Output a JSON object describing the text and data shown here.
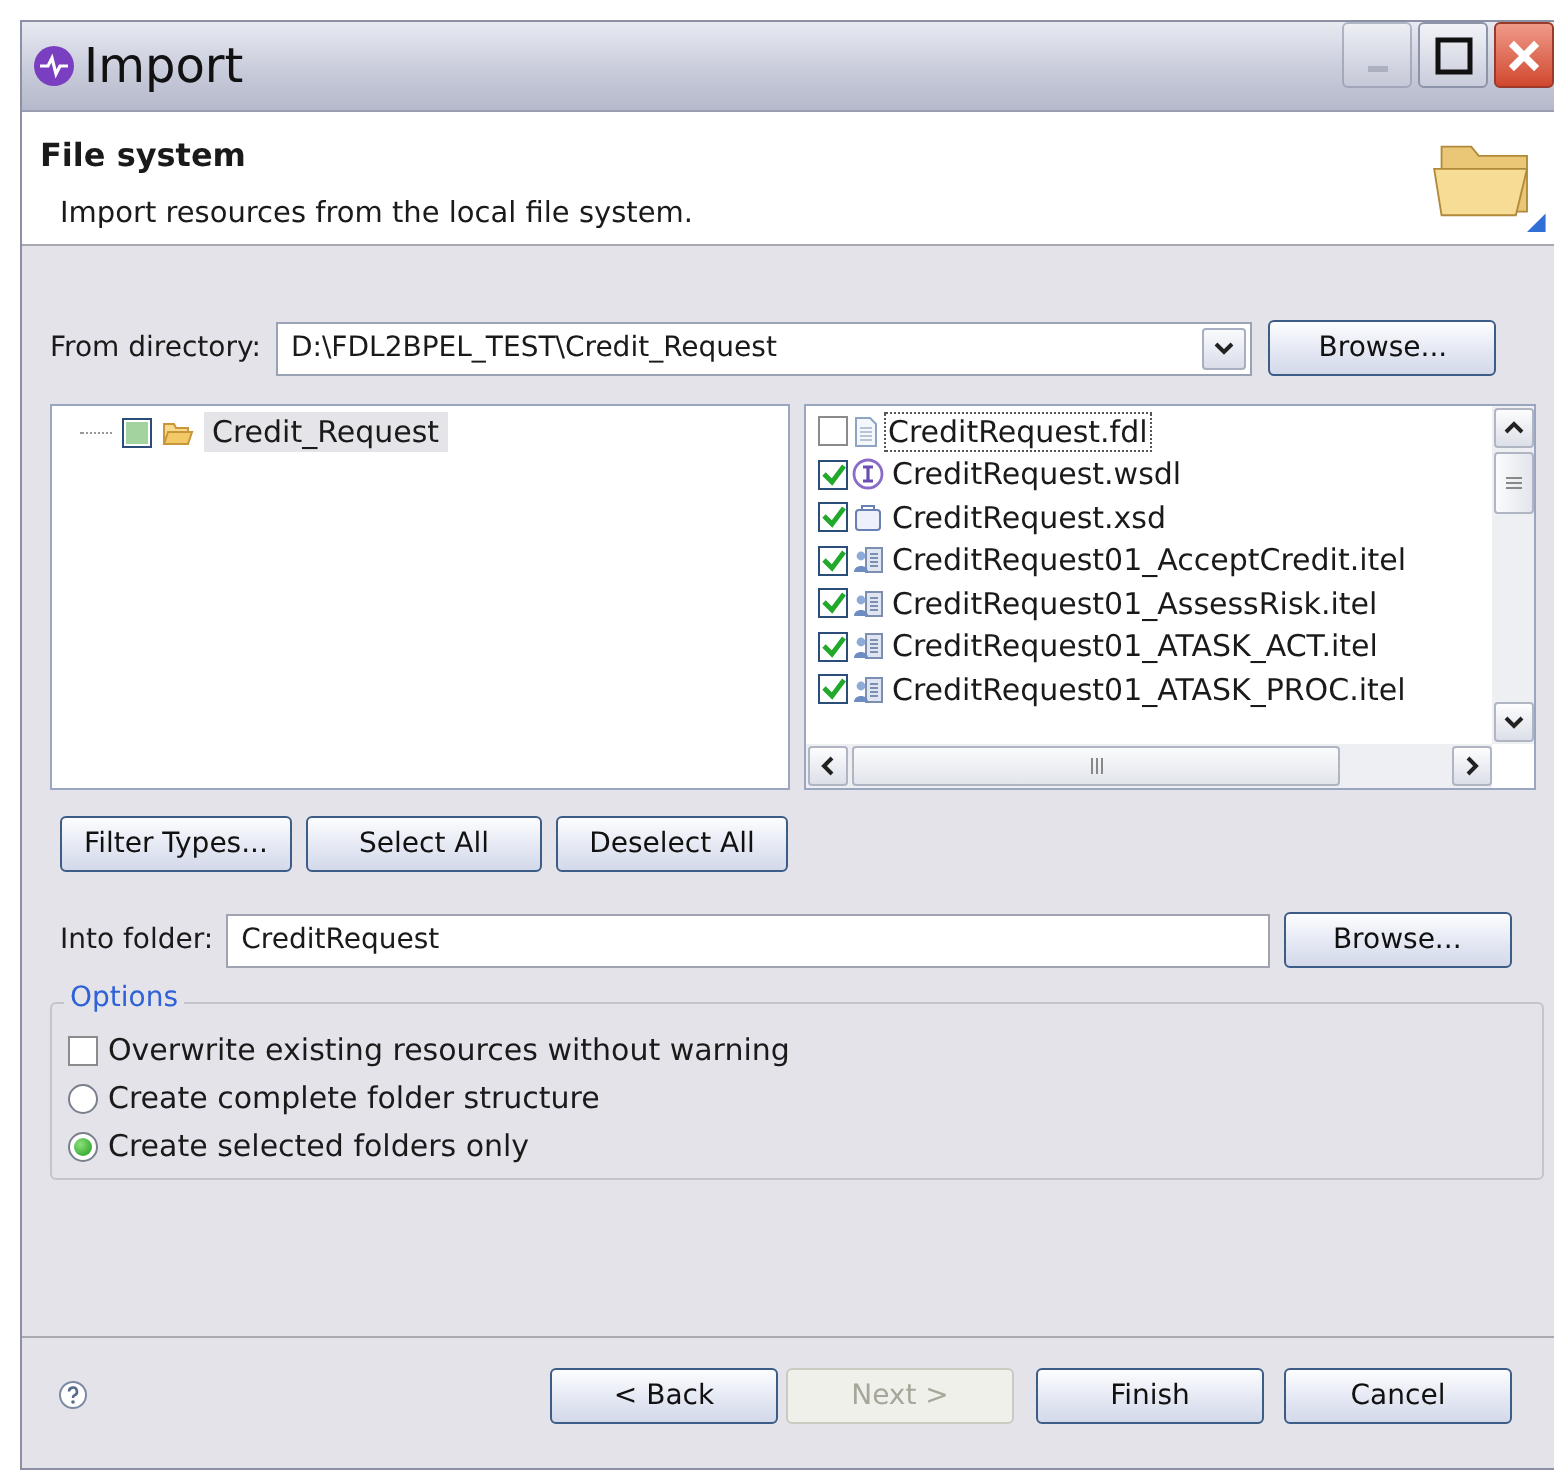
{
  "window": {
    "title": "Import"
  },
  "header": {
    "title": "File system",
    "description": "Import resources from the local file system."
  },
  "from_directory": {
    "label": "From directory:",
    "value": "D:\\FDL2BPEL_TEST\\Credit_Request",
    "browse": "Browse..."
  },
  "folder_tree": [
    {
      "label": "Credit_Request",
      "checked": true,
      "grayed": true,
      "selected": true
    }
  ],
  "files": [
    {
      "name": "CreditRequest.fdl",
      "kind": "document",
      "checked": false,
      "focused": true
    },
    {
      "name": "CreditRequest.wsdl",
      "kind": "interface",
      "checked": true,
      "focused": false
    },
    {
      "name": "CreditRequest.xsd",
      "kind": "schema",
      "checked": true,
      "focused": false
    },
    {
      "name": "CreditRequest01_AcceptCredit.itel",
      "kind": "task",
      "checked": true,
      "focused": false
    },
    {
      "name": "CreditRequest01_AssessRisk.itel",
      "kind": "task",
      "checked": true,
      "focused": false
    },
    {
      "name": "CreditRequest01_ATASK_ACT.itel",
      "kind": "task",
      "checked": true,
      "focused": false
    },
    {
      "name": "CreditRequest01_ATASK_PROC.itel",
      "kind": "task",
      "checked": true,
      "focused": false
    }
  ],
  "selection_buttons": [
    "Filter Types...",
    "Select All",
    "Deselect All"
  ],
  "into_folder": {
    "label": "Into folder:",
    "value": "CreditRequest",
    "browse": "Browse..."
  },
  "options": {
    "title": "Options",
    "items": [
      {
        "kind": "checkbox",
        "label": "Overwrite existing resources without warning",
        "checked": false
      },
      {
        "kind": "radio",
        "label": "Create complete folder structure",
        "selected": false
      },
      {
        "kind": "radio",
        "label": "Create selected folders only",
        "selected": true
      }
    ]
  },
  "footer_buttons": [
    {
      "label": "< Back",
      "disabled": false
    },
    {
      "label": "Next >",
      "disabled": true
    },
    {
      "label": "Finish",
      "disabled": false
    },
    {
      "label": "Cancel",
      "disabled": false
    }
  ]
}
